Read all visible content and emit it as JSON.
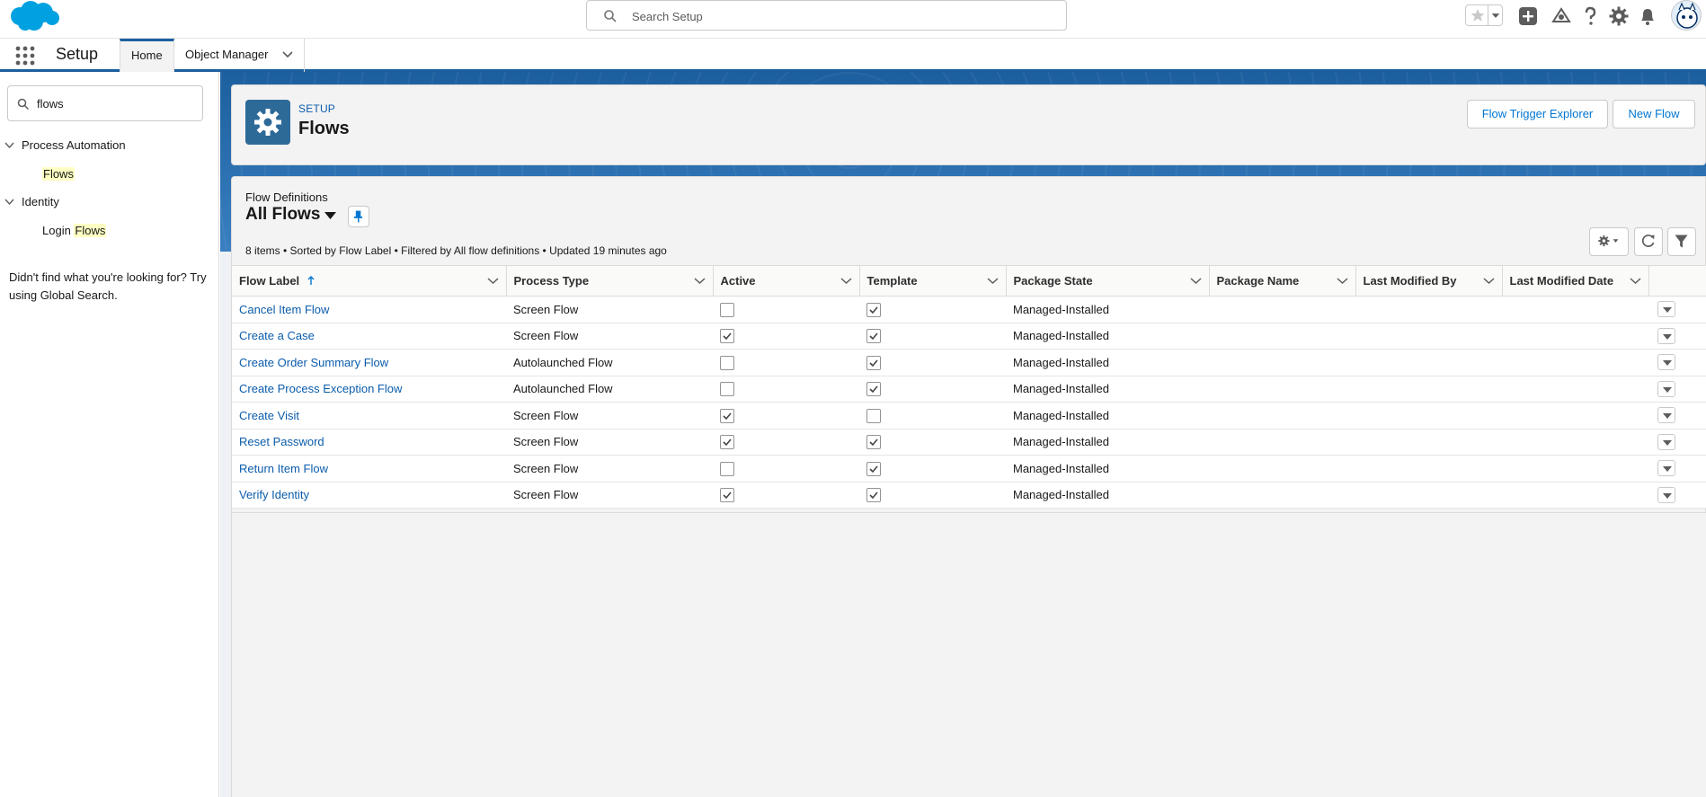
{
  "global_header": {
    "search_placeholder": "Search Setup",
    "icons": [
      "favorites-star-icon",
      "favorites-menu-icon",
      "global-create-icon",
      "trailhead-icon",
      "help-icon",
      "setup-gear-icon",
      "notifications-bell-icon",
      "user-avatar"
    ]
  },
  "context_bar": {
    "app_name": "Setup",
    "tabs": [
      {
        "label": "Home",
        "active": true
      },
      {
        "label": "Object Manager",
        "has_menu": true
      }
    ]
  },
  "sidebar": {
    "quick_find_value": "flows",
    "tree": [
      {
        "label": "Process Automation",
        "expanded": true,
        "children": [
          {
            "prefix": "",
            "highlight": "Flows"
          }
        ]
      },
      {
        "label": "Identity",
        "expanded": true,
        "children": [
          {
            "prefix": "Login ",
            "highlight": "Flows"
          }
        ]
      }
    ],
    "not_found_text": "Didn't find what you're looking for? Try using Global Search."
  },
  "page_header": {
    "subtitle": "SETUP",
    "title": "Flows",
    "buttons": {
      "flow_trigger_explorer": "Flow Trigger Explorer",
      "new_flow": "New Flow"
    }
  },
  "list_view": {
    "object_label": "Flow Definitions",
    "view_name": "All Flows",
    "info": "8 items • Sorted by Flow Label • Filtered by All flow definitions • Updated 19 minutes ago",
    "columns": [
      "Flow Label",
      "Process Type",
      "Active",
      "Template",
      "Package State",
      "Package Name",
      "Last Modified By",
      "Last Modified Date"
    ],
    "sorted_column": "Flow Label",
    "rows": [
      {
        "label": "Cancel Item Flow",
        "process_type": "Screen Flow",
        "active": false,
        "template": true,
        "package_state": "Managed-Installed",
        "package_name": "",
        "last_modified_by": "",
        "last_modified_date": ""
      },
      {
        "label": "Create a Case",
        "process_type": "Screen Flow",
        "active": true,
        "template": true,
        "package_state": "Managed-Installed",
        "package_name": "",
        "last_modified_by": "",
        "last_modified_date": ""
      },
      {
        "label": "Create Order Summary Flow",
        "process_type": "Autolaunched Flow",
        "active": false,
        "template": true,
        "package_state": "Managed-Installed",
        "package_name": "",
        "last_modified_by": "",
        "last_modified_date": ""
      },
      {
        "label": "Create Process Exception Flow",
        "process_type": "Autolaunched Flow",
        "active": false,
        "template": true,
        "package_state": "Managed-Installed",
        "package_name": "",
        "last_modified_by": "",
        "last_modified_date": ""
      },
      {
        "label": "Create Visit",
        "process_type": "Screen Flow",
        "active": true,
        "template": false,
        "package_state": "Managed-Installed",
        "package_name": "",
        "last_modified_by": "",
        "last_modified_date": ""
      },
      {
        "label": "Reset Password",
        "process_type": "Screen Flow",
        "active": true,
        "template": true,
        "package_state": "Managed-Installed",
        "package_name": "",
        "last_modified_by": "",
        "last_modified_date": ""
      },
      {
        "label": "Return Item Flow",
        "process_type": "Screen Flow",
        "active": false,
        "template": true,
        "package_state": "Managed-Installed",
        "package_name": "",
        "last_modified_by": "",
        "last_modified_date": ""
      },
      {
        "label": "Verify Identity",
        "process_type": "Screen Flow",
        "active": true,
        "template": true,
        "package_state": "Managed-Installed",
        "package_name": "",
        "last_modified_by": "",
        "last_modified_date": ""
      }
    ]
  },
  "colors": {
    "brand_blue": "#0176d3",
    "link_blue": "#0b5cab",
    "band_blue": "#1b5f9e",
    "setup_icon_bg": "#2e6a98",
    "search_highlight": "#ffffc4"
  }
}
